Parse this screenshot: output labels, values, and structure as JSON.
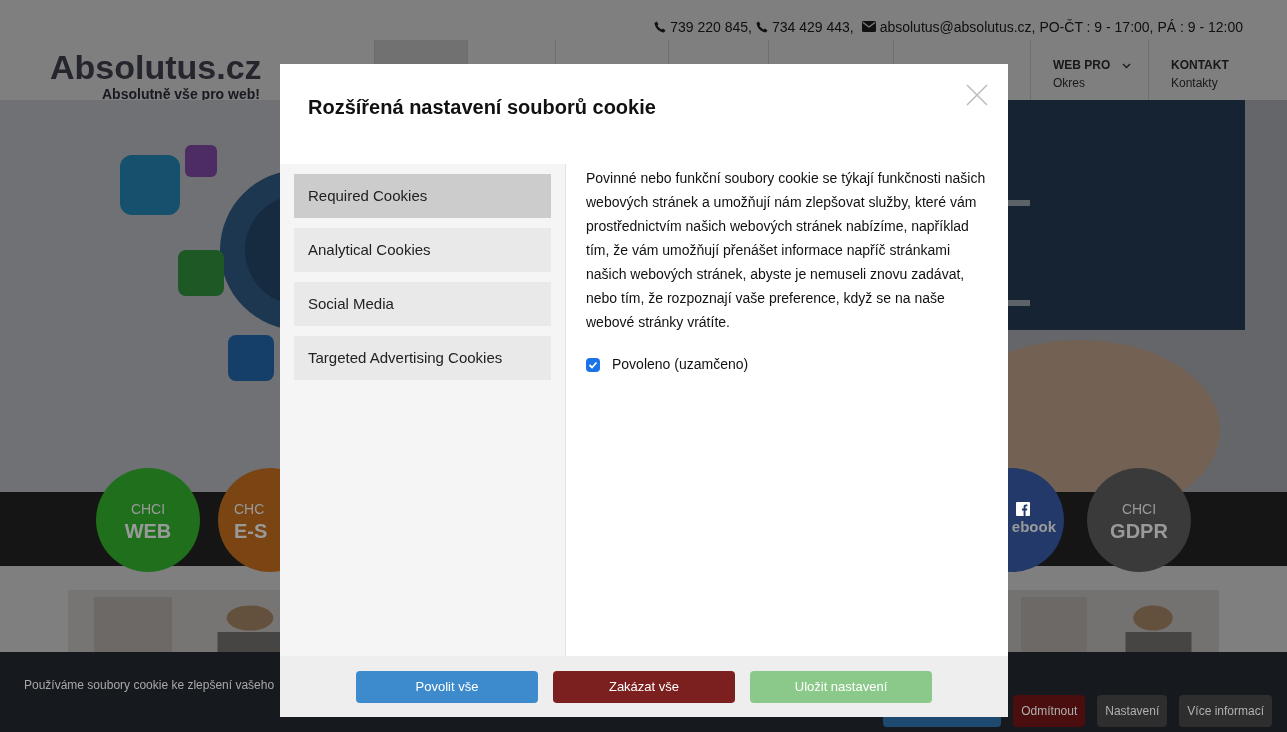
{
  "contact": {
    "phone_1": "739 220 845,",
    "phone_2": "734 429 443,",
    "email": "absolutus@absolutus.cz, PO-ČT : 9 - 17:00, PÁ : 9 - 12:00"
  },
  "logo": {
    "name": "Absolutus.cz",
    "tagline": "Absolutně vše pro web!"
  },
  "nav": [
    {
      "label": "WEB PRO",
      "sub": "Okres",
      "kind": "dropdown"
    },
    {
      "label": "KONTAKT",
      "sub": "Kontakty",
      "kind": "link"
    }
  ],
  "circles": [
    {
      "top": "CHCI",
      "main": "WEB",
      "color": "#1f6f1c"
    },
    {
      "top": "CHC",
      "main": "E-S",
      "color": "#7a4512"
    },
    {
      "main": "ebook",
      "color": "#22396a"
    },
    {
      "top": "CHCI",
      "main": "GDPR",
      "color": "#3a3a3a"
    }
  ],
  "cookie_bar": {
    "text": "Používáme soubory cookie ke zlepšení vašeho",
    "buttons": [
      "Odmítnout",
      "Nastavení",
      "Více informací"
    ]
  },
  "modal": {
    "title": "Rozšířená nastavení souborů cookie",
    "categories": [
      {
        "label": "Required Cookies",
        "selected": true
      },
      {
        "label": "Analytical Cookies",
        "selected": false
      },
      {
        "label": "Social Media",
        "selected": false
      },
      {
        "label": "Targeted Advertising Cookies",
        "selected": false
      }
    ],
    "description": "Povinné nebo funkční soubory cookie se týkají funkčnosti našich webových stránek a umožňují nám zlepšovat služby, které vám prostřednictvím našich webových stránek nabízíme, například tím, že vám umožňují přenášet informace napříč stránkami našich webových stránek, abyste je nemuseli znovu zadávat, nebo tím, že rozpoznají vaše preference, když se na naše webové stránky vrátíte.",
    "toggle": {
      "label": "Povoleno (uzamčeno)",
      "checked": true
    },
    "buttons": [
      {
        "label": "Povolit vše",
        "kind": "allow"
      },
      {
        "label": "Zakázat vše",
        "kind": "deny"
      },
      {
        "label": "Uložit nastavení",
        "kind": "save"
      }
    ]
  }
}
